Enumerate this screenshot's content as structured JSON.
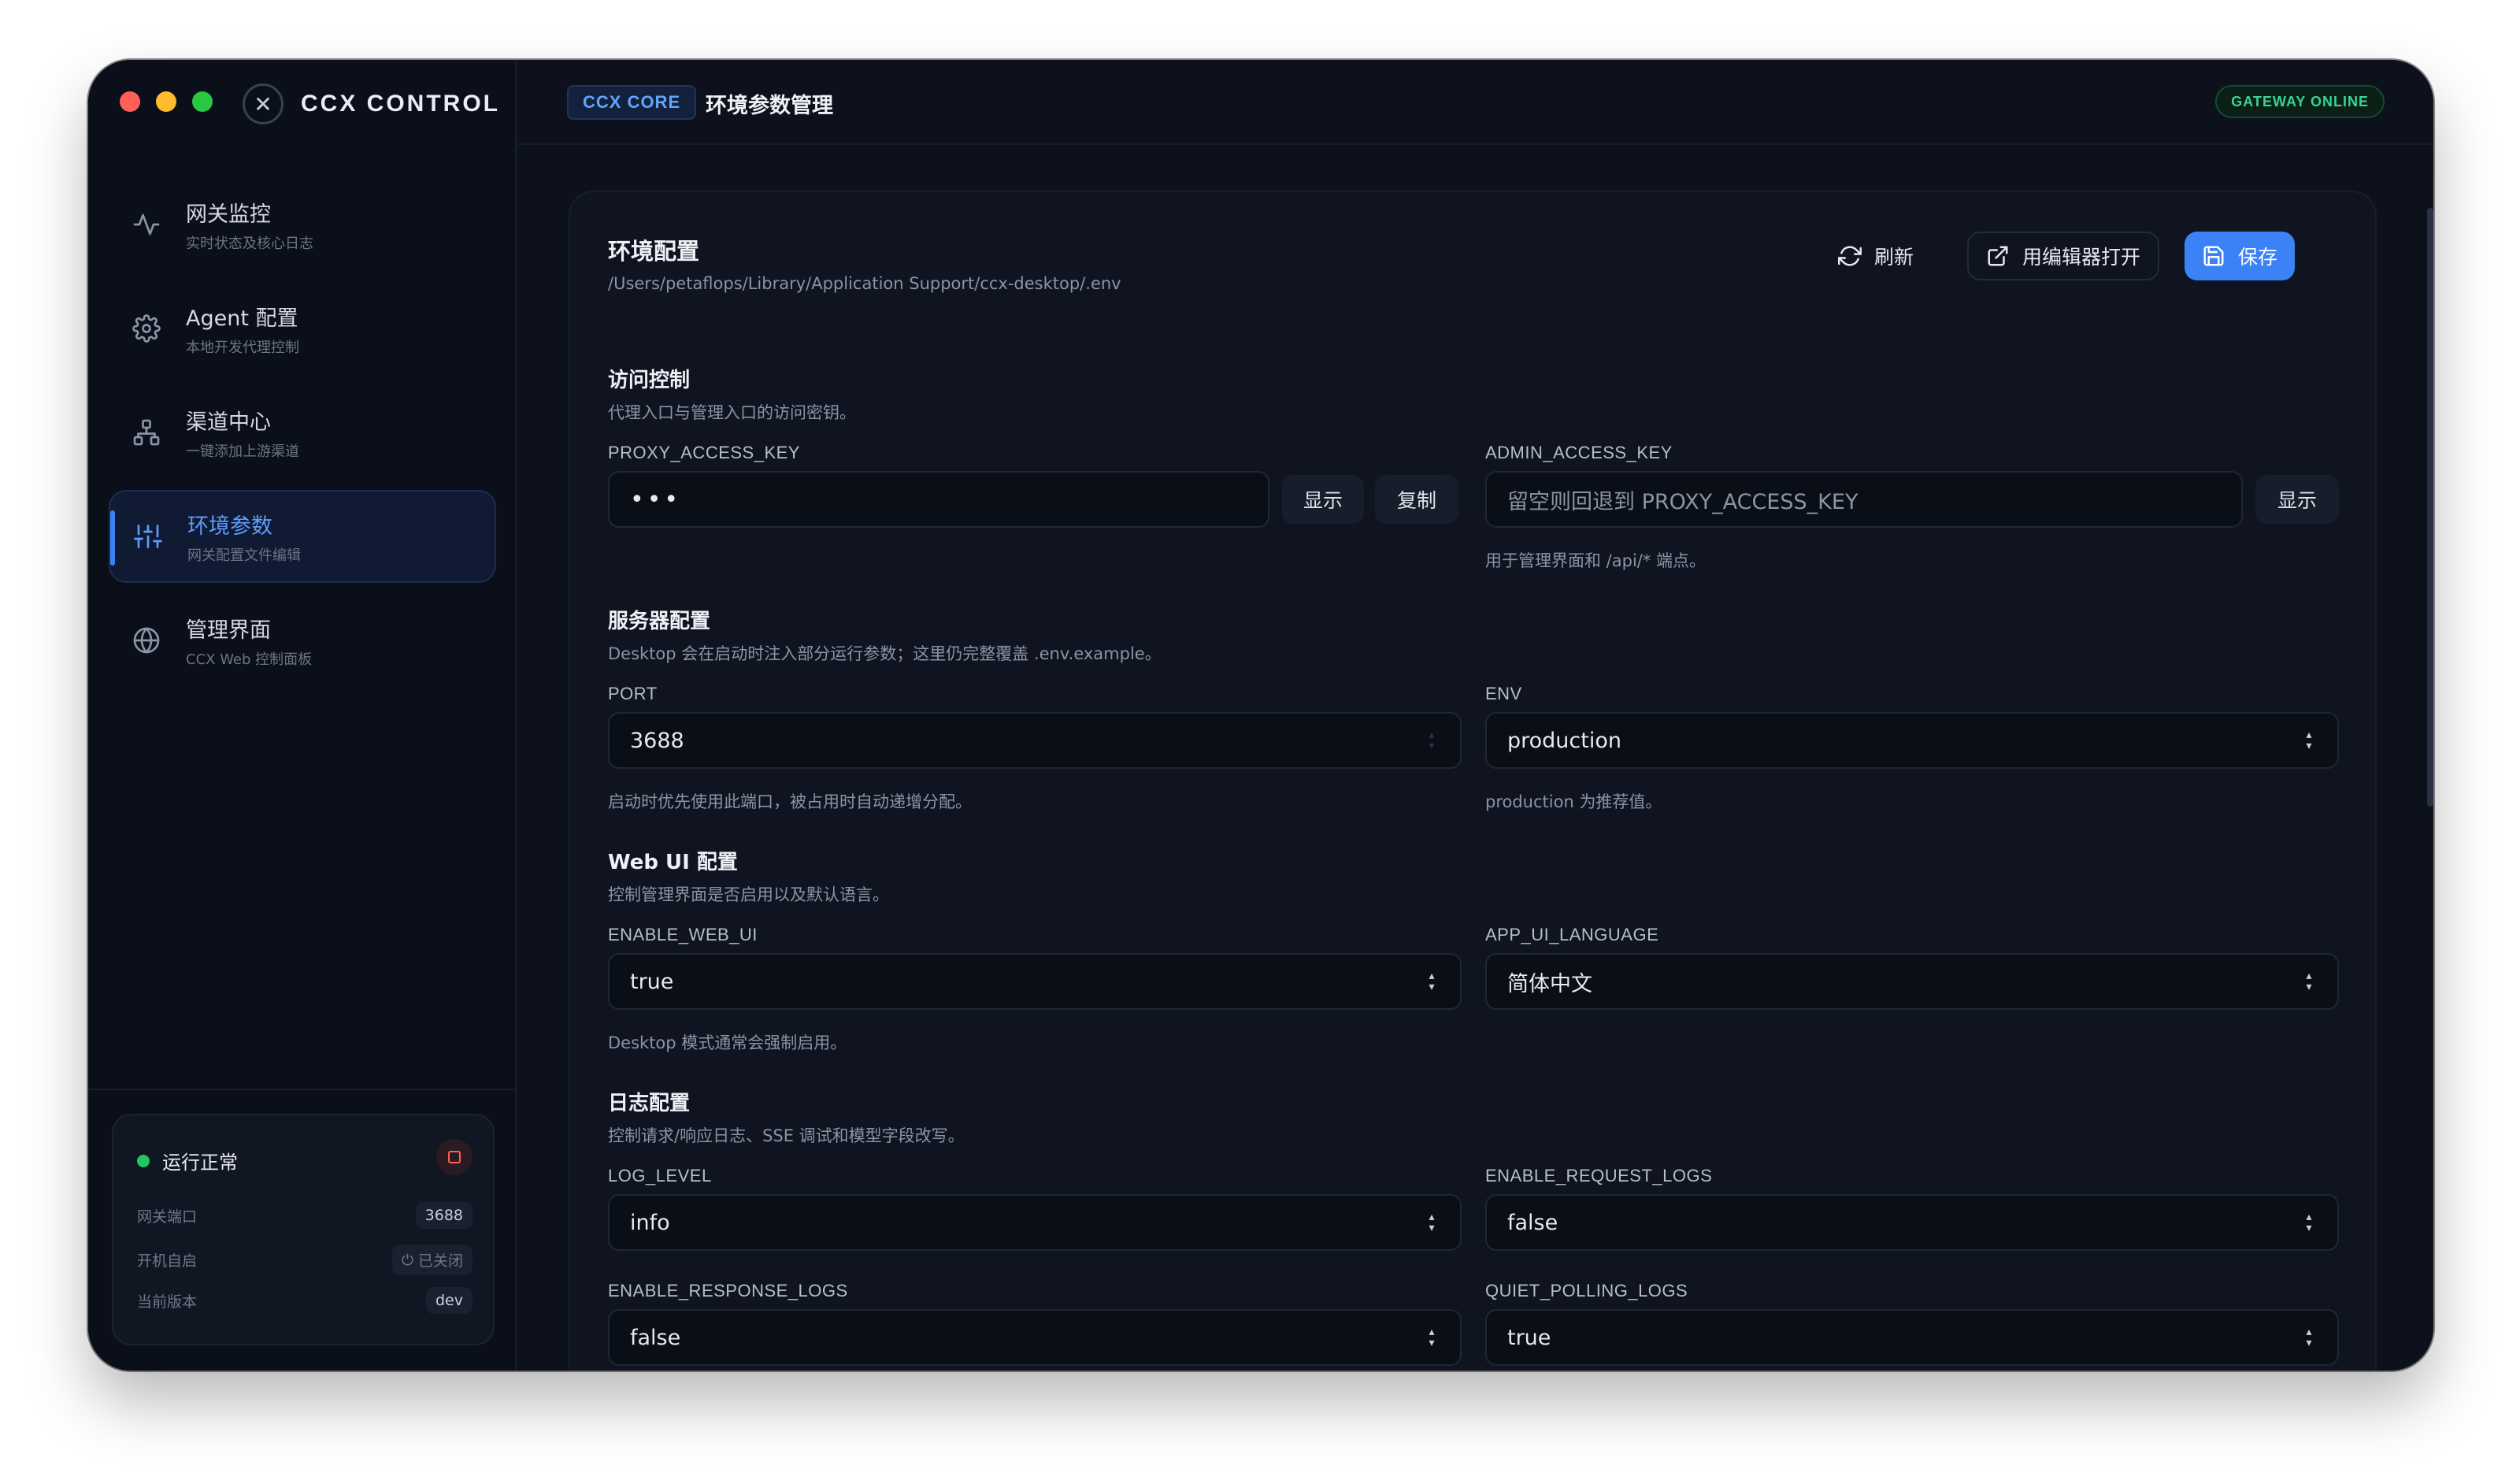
{
  "sidebar": {
    "brand": "CCX CONTROL",
    "items": [
      {
        "title": "网关监控",
        "sub": "实时状态及核心日志",
        "icon": "activity-icon"
      },
      {
        "title": "Agent 配置",
        "sub": "本地开发代理控制",
        "icon": "gear-icon"
      },
      {
        "title": "渠道中心",
        "sub": "一键添加上游渠道",
        "icon": "network-icon"
      },
      {
        "title": "环境参数",
        "sub": "网关配置文件编辑",
        "icon": "sliders-icon",
        "active": true
      },
      {
        "title": "管理界面",
        "sub": "CCX Web 控制面板",
        "icon": "globe-icon"
      }
    ],
    "status": {
      "title": "运行正常",
      "rows": [
        {
          "label": "网关端口",
          "value": "3688"
        },
        {
          "label": "开机自启",
          "value": "已关闭"
        },
        {
          "label": "当前版本",
          "value": "dev"
        }
      ]
    }
  },
  "header": {
    "badge": "CCX CORE",
    "title": "环境参数管理",
    "status": "GATEWAY ONLINE"
  },
  "panel": {
    "title": "环境配置",
    "path": "/Users/petaflops/Library/Application Support/ccx-desktop/.env",
    "refresh": "刷新",
    "open_editor": "用编辑器打开",
    "save": "保存"
  },
  "access": {
    "title": "访问控制",
    "desc": "代理入口与管理入口的访问密钥。",
    "proxy_label": "PROXY_ACCESS_KEY",
    "proxy_value": "•••",
    "show": "显示",
    "copy": "复制",
    "admin_label": "ADMIN_ACCESS_KEY",
    "admin_placeholder": "留空则回退到 PROXY_ACCESS_KEY",
    "admin_help": "用于管理界面和 /api/* 端点。"
  },
  "server": {
    "title": "服务器配置",
    "desc": "Desktop 会在启动时注入部分运行参数；这里仍完整覆盖 .env.example。",
    "port_label": "PORT",
    "port_value": "3688",
    "port_help": "启动时优先使用此端口，被占用时自动递增分配。",
    "env_label": "ENV",
    "env_value": "production",
    "env_help": "production 为推荐值。"
  },
  "webui": {
    "title": "Web UI 配置",
    "desc": "控制管理界面是否启用以及默认语言。",
    "enable_label": "ENABLE_WEB_UI",
    "enable_value": "true",
    "enable_help": "Desktop 模式通常会强制启用。",
    "lang_label": "APP_UI_LANGUAGE",
    "lang_value": "简体中文"
  },
  "logs": {
    "title": "日志配置",
    "desc": "控制请求/响应日志、SSE 调试和模型字段改写。",
    "level_label": "LOG_LEVEL",
    "level_value": "info",
    "req_label": "ENABLE_REQUEST_LOGS",
    "req_value": "false",
    "resp_label": "ENABLE_RESPONSE_LOGS",
    "resp_value": "false",
    "quiet_label": "QUIET_POLLING_LOGS",
    "quiet_value": "true"
  },
  "colors": {
    "accent": "#3b82f6",
    "online": "#34d399",
    "stop": "#ff5b5b"
  }
}
